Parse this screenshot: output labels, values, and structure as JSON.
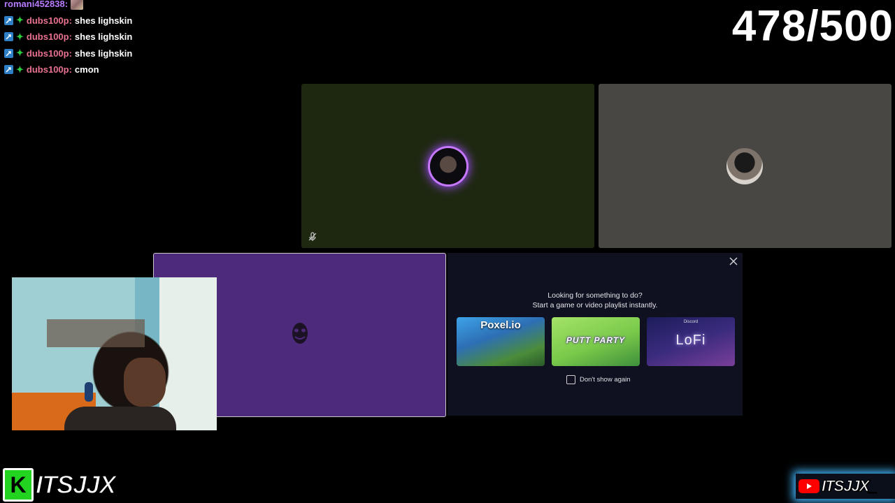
{
  "chat": {
    "messages": [
      {
        "user": "romani452838:",
        "text": "",
        "emote": true,
        "badges": false
      },
      {
        "user": "dubs100p:",
        "text": "shes lighskin",
        "emote": false,
        "badges": true
      },
      {
        "user": "dubs100p:",
        "text": "shes lighskin",
        "emote": false,
        "badges": true
      },
      {
        "user": "dubs100p:",
        "text": "shes lighskin",
        "emote": false,
        "badges": true
      },
      {
        "user": "dubs100p:",
        "text": "cmon",
        "emote": false,
        "badges": true
      }
    ]
  },
  "counter": "478/500",
  "activities": {
    "title_line1": "Looking for something to do?",
    "title_line2": "Start a game or video playlist instantly.",
    "cards": [
      {
        "label": "Poxel.io",
        "icon": "poxel-game-thumbnail"
      },
      {
        "label": "PUTT PARTY",
        "icon": "putt-party-game-thumbnail"
      },
      {
        "sub": "Discord",
        "label": "LoFi",
        "icon": "lofi-playlist-thumbnail"
      }
    ],
    "dont_show_again": "Don't show again"
  },
  "branding": {
    "left_k": "K",
    "left_text": "ITSJJX",
    "right_text": "ITSJJX_"
  },
  "colors": {
    "speaking_ring": "#c678ff",
    "tile_olive": "#1e2811",
    "tile_gray": "#484744",
    "tile_purple": "#4e2a7c",
    "panel_bg": "#0f1020",
    "kick_green": "#22d41f",
    "youtube_red": "#ff0000"
  }
}
